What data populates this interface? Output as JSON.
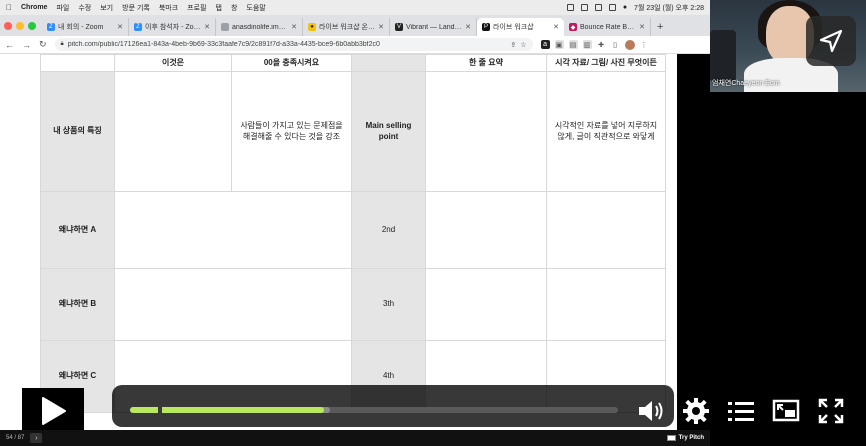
{
  "menubar": {
    "app": "Chrome",
    "items": [
      "파일",
      "수정",
      "보기",
      "방문 기록",
      "북마크",
      "프로필",
      "탭",
      "창",
      "도움말"
    ],
    "clock": "7월 23일 (월) 오후 2:28"
  },
  "tabs": [
    {
      "title": "내 회의 - Zoom",
      "color": "#2d8cff"
    },
    {
      "title": "이후 참석자 - Zoom",
      "color": "#2d8cff"
    },
    {
      "title": "anasdinolife.imweb",
      "color": "#9aa0a6"
    },
    {
      "title": "라이브 워크샵 온라인 과정",
      "color": "#f4c20d"
    },
    {
      "title": "Vibrant — Landing",
      "color": "#222222"
    },
    {
      "title": "라이브 워크샵",
      "color": "#111111",
      "active": true
    },
    {
      "title": "Bounce Rate Bench",
      "color": "#c2185b"
    }
  ],
  "address": {
    "url": "pitch.com/public/17126ea1-843a-4beb-9b69-33c3faafe7c9/2c891f7d-a33a-4435-bce9-6b0abb3bf2c0"
  },
  "table": {
    "headers": [
      "",
      "이것은",
      "00을 충족시켜요",
      "",
      "한 줄 요약",
      "시각 자료/ 그림/ 사진 무엇이든"
    ],
    "rows": [
      {
        "label": "내 상품의 특징",
        "c1": "",
        "c2": "사람들이 가지고 있는 문제점을 해결해줄 수 있다는 것을 강조",
        "mid": "Main selling point",
        "c4": "",
        "c5": "시각적인 자료를 넣어 지루하지 않게, 글이 직관적으로 와닿게"
      },
      {
        "label": "왜냐하면 A",
        "c1": "",
        "c2": "",
        "mid": "2nd",
        "c4": "",
        "c5": ""
      },
      {
        "label": "왜냐하면 B",
        "c1": "",
        "c2": "",
        "mid": "3th",
        "c4": "",
        "c5": ""
      },
      {
        "label": "왜냐하면 C",
        "c1": "",
        "c2": "",
        "mid": "4th",
        "c4": "",
        "c5": ""
      }
    ]
  },
  "webcam": {
    "name": "엄채연Chaeyeon Eom"
  },
  "player": {
    "time": "34:53",
    "progress": 0.398,
    "buffered": 0.41,
    "accent": "#b9e85c"
  },
  "pitch_footer": {
    "page": "54 / 87",
    "try": "Try Pitch"
  },
  "icons": [
    "apple-icon",
    "back-icon",
    "forward-icon",
    "reload-icon",
    "lock-icon",
    "play-icon",
    "volume-icon",
    "settings-icon",
    "chapters-icon",
    "pip-icon",
    "fullscreen-icon",
    "share-icon"
  ]
}
